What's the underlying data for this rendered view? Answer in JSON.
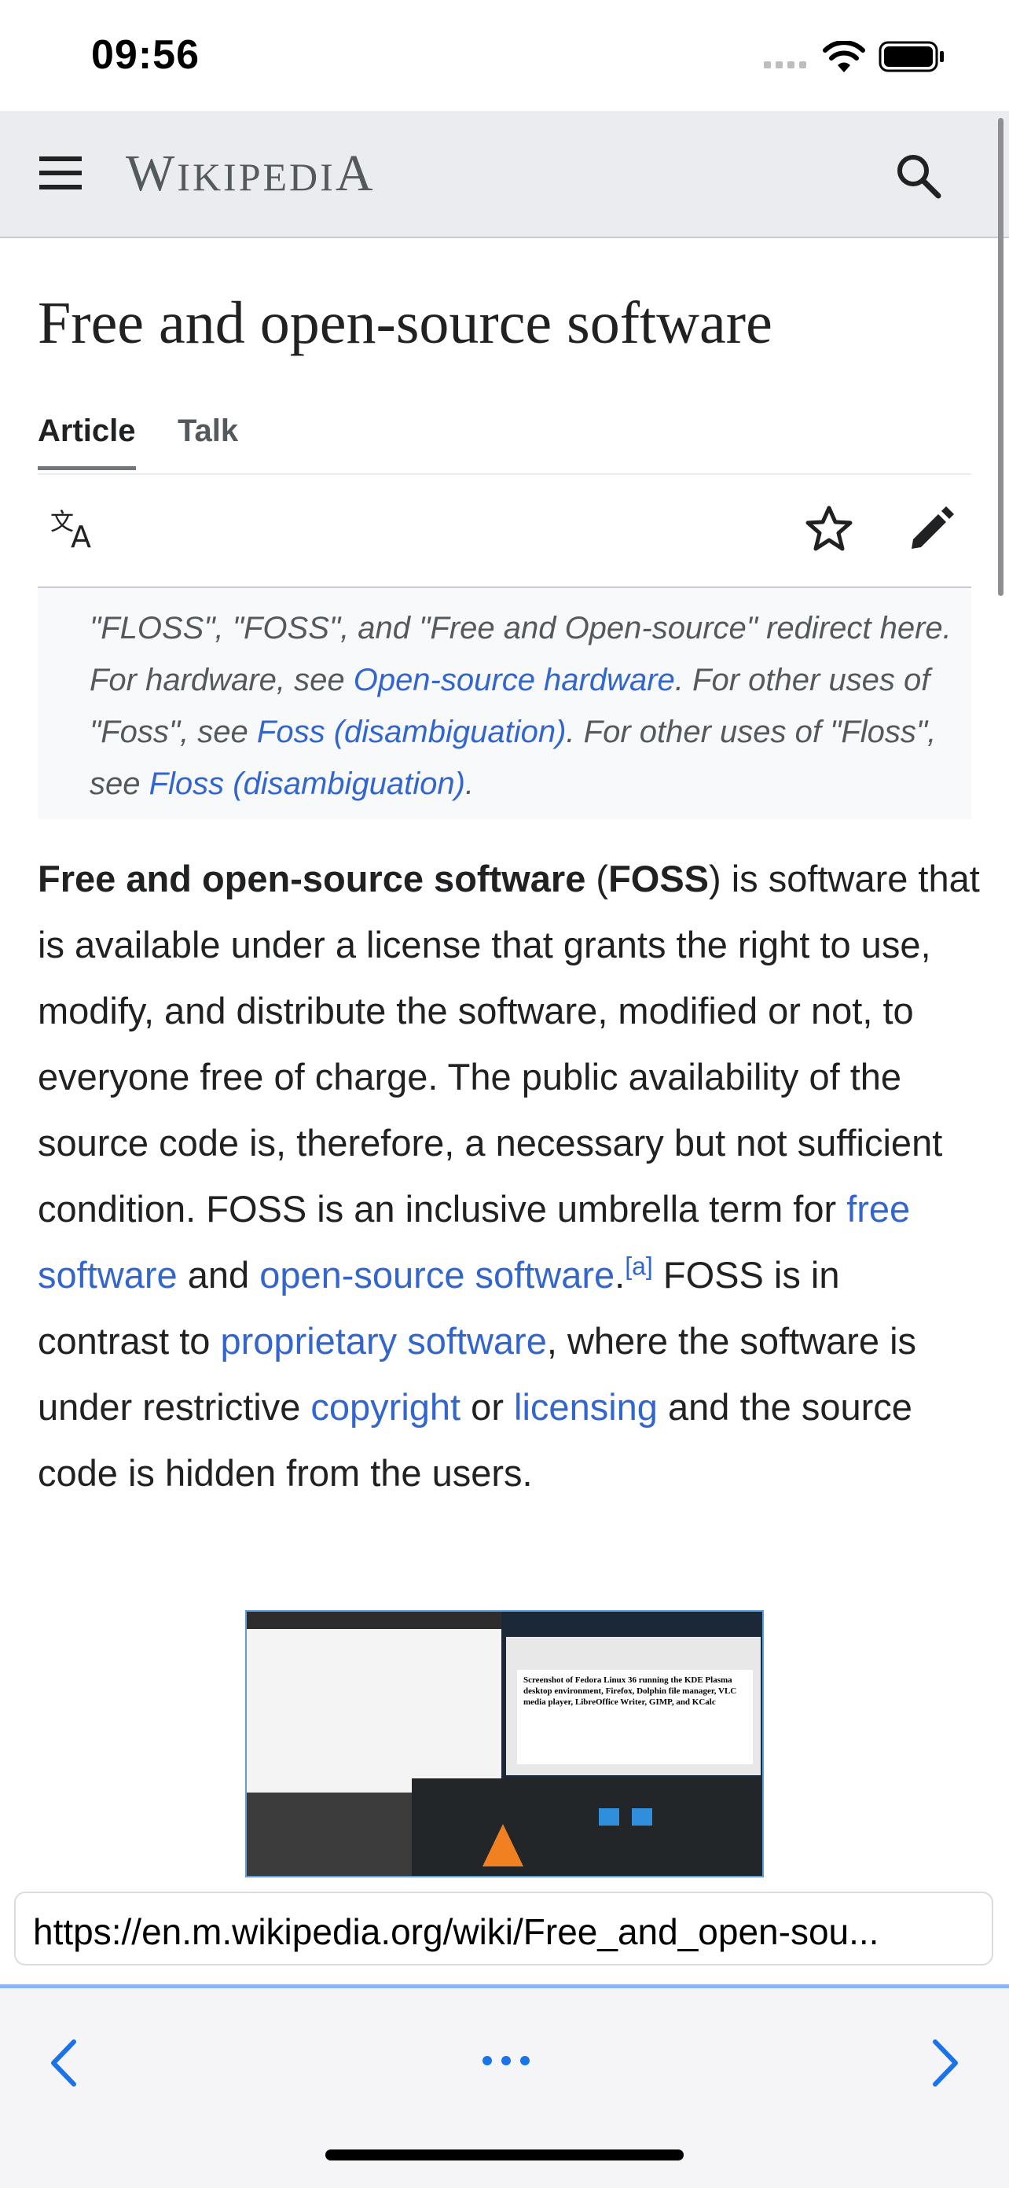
{
  "status_bar": {
    "time": "09:56"
  },
  "header": {
    "logo": "Wikipedia",
    "menu_icon": "hamburger-icon",
    "search_icon": "search-icon"
  },
  "page": {
    "title": "Free and open-source software",
    "tabs": [
      {
        "label": "Article",
        "active": true
      },
      {
        "label": "Talk",
        "active": false
      }
    ],
    "actions": {
      "language_icon": "language-icon",
      "watch_icon": "star-icon",
      "edit_icon": "pencil-icon"
    },
    "hatnote": {
      "t1": "\"FLOSS\", \"FOSS\", and \"Free and Open-source\" redirect here. For hardware, see ",
      "l1": "Open-source hardware",
      "t2": ". For other uses of \"Foss\", see ",
      "l2": "Foss (disambiguation)",
      "t3": ". For other uses of \"Floss\", see ",
      "l3": "Floss (disambiguation)",
      "t4": "."
    },
    "lead": {
      "b1": "Free and open-source software",
      "t1": " (",
      "b2": "FOSS",
      "t2": ") is software that is available under a license that grants the right to use, modify, and distribute the software, modified or not, to everyone free of charge. The public availability of the source code is, therefore, a necessary but not sufficient condition. FOSS is an inclusive umbrella term for ",
      "l1": "free software",
      "t3": " and ",
      "l2": "open-source software",
      "t4": ".",
      "note": "[a]",
      "t5": " FOSS is in contrast to ",
      "l3": "proprietary software",
      "t6": ", where the software is under restrictive ",
      "l4": "copyright",
      "t7": " or ",
      "l5": "licensing",
      "t8": " and the source code is hidden from the users."
    },
    "figure": {
      "caption_in_image": "Screenshot of Fedora Linux 36 running the KDE Plasma desktop environment, Firefox, Dolphin file manager, VLC media player, LibreOffice Writer, GIMP, and KCalc"
    }
  },
  "browser": {
    "url": "https://en.m.wikipedia.org/wiki/Free_and_open-sou...",
    "back_icon": "chevron-left-icon",
    "more_icon": "ellipsis-icon",
    "forward_icon": "chevron-right-icon"
  },
  "colors": {
    "link": "#3366cc",
    "text": "#202122",
    "header_bg": "#eaecf0",
    "hatnote_bg": "#f8f9fa",
    "toolbar_accent": "#8ab4f8"
  }
}
